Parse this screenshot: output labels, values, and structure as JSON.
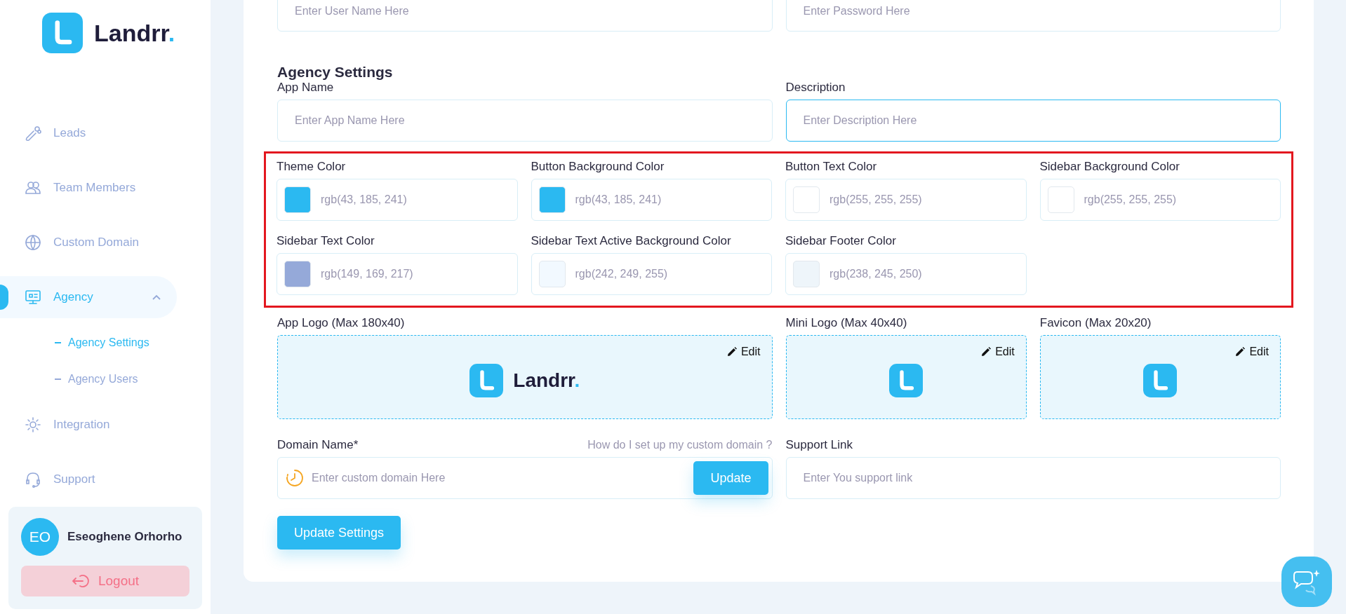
{
  "sidebar": {
    "brand": {
      "name": "Landrr",
      "dot": "."
    },
    "nav": [
      {
        "label": "Leads",
        "selected": false
      },
      {
        "label": "Team Members",
        "selected": false
      },
      {
        "label": "Custom Domain",
        "selected": false
      },
      {
        "label": "Agency",
        "selected": true,
        "expanded": true,
        "children": [
          {
            "label": "Agency Settings",
            "selected": true
          },
          {
            "label": "Agency Users",
            "selected": false
          }
        ]
      },
      {
        "label": "Integration",
        "selected": false
      },
      {
        "label": "Support",
        "selected": false
      }
    ],
    "user": {
      "initials": "EO",
      "name": "Eseoghene Orhorho"
    },
    "logout": "Logout"
  },
  "top_fields": [
    {
      "placeholder": "Enter User Name Here"
    },
    {
      "placeholder": "Enter Password Here"
    }
  ],
  "agency_settings": {
    "title": "Agency Settings",
    "fields": [
      {
        "label": "App Name",
        "placeholder": "Enter App Name Here",
        "focused": false
      },
      {
        "label": "Description",
        "placeholder": "Enter Description Here",
        "focused": true
      }
    ],
    "colors": [
      {
        "label": "Theme Color",
        "value": "rgb(43, 185, 241)",
        "color": "#2bb9f1"
      },
      {
        "label": "Button Background Color",
        "value": "rgb(43, 185, 241)",
        "color": "#2bb9f1"
      },
      {
        "label": "Button Text Color",
        "value": "rgb(255, 255, 255)",
        "color": "#ffffff"
      },
      {
        "label": "Sidebar Background Color",
        "value": "rgb(255, 255, 255)",
        "color": "#ffffff"
      },
      {
        "label": "Sidebar Text Color",
        "value": "rgb(149, 169, 217)",
        "color": "#95a9d9"
      },
      {
        "label": "Sidebar Text Active Background Color",
        "value": "rgb(242, 249, 255)",
        "color": "#f2f9ff"
      },
      {
        "label": "Sidebar Footer Color",
        "value": "rgb(238, 245, 250)",
        "color": "#eef5fa"
      }
    ],
    "logos": [
      {
        "label": "App Logo (Max 180x40)",
        "kind": "full",
        "edit": "Edit",
        "brand": {
          "name": "Landrr",
          "dot": "."
        }
      },
      {
        "label": "Mini Logo (Max 40x40)",
        "kind": "mini",
        "edit": "Edit"
      },
      {
        "label": "Favicon (Max 20x20)",
        "kind": "mini",
        "edit": "Edit"
      }
    ],
    "domain": {
      "label": "Domain Name*",
      "help": "How do I set up my custom domain ?",
      "placeholder": "Enter custom domain Here",
      "button": "Update"
    },
    "support": {
      "label": "Support Link",
      "placeholder": "Enter You support link"
    },
    "submit": "Update Settings"
  }
}
